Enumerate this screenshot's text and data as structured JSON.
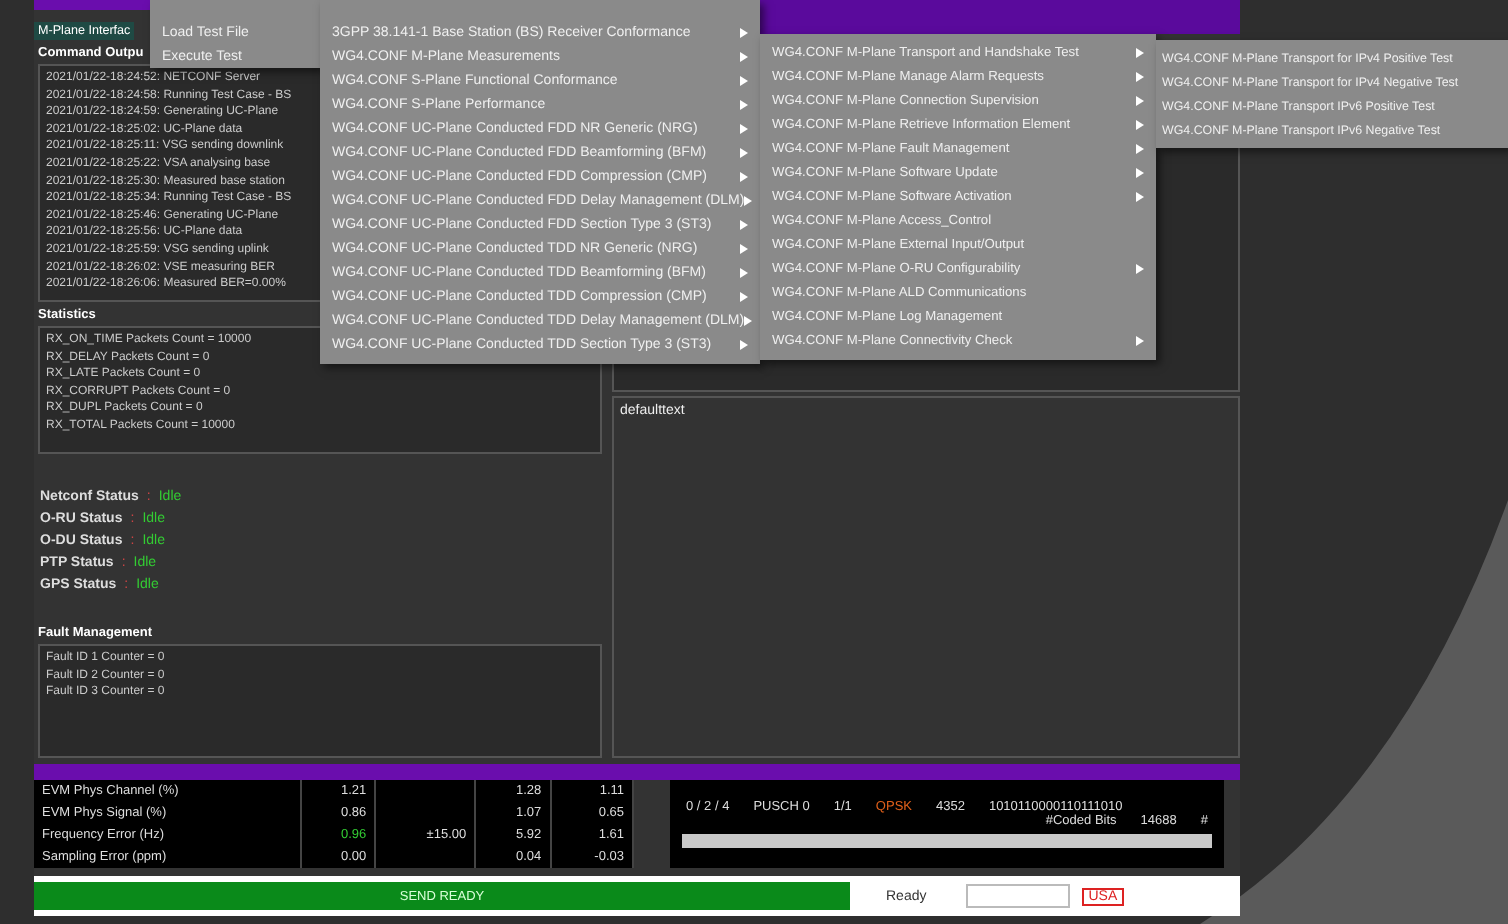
{
  "interface_tab": "M-Plane Interfac",
  "command_output": {
    "title": "Command Outpu",
    "lines": [
      "2021/01/22-18:24:52: NETCONF Server",
      "2021/01/22-18:24:58: Running Test Case - BS",
      "2021/01/22-18:24:59: Generating UC-Plane",
      "2021/01/22-18:25:02: UC-Plane data",
      "2021/01/22-18:25:11: VSG sending downlink",
      "2021/01/22-18:25:22: VSA analysing base",
      "2021/01/22-18:25:30: Measured base station",
      "2021/01/22-18:25:34: Running Test Case - BS",
      "2021/01/22-18:25:46: Generating UC-Plane",
      "2021/01/22-18:25:56: UC-Plane data",
      "2021/01/22-18:25:59: VSG sending uplink",
      "2021/01/22-18:26:02: VSE measuring BER",
      "2021/01/22-18:26:06: Measured BER=0.00%"
    ]
  },
  "statistics": {
    "title": "Statistics",
    "lines": [
      "RX_ON_TIME Packets Count = 10000",
      "RX_DELAY Packets Count = 0",
      "RX_LATE Packets Count = 0",
      "RX_CORRUPT Packets Count = 0",
      "RX_DUPL Packets Count = 0",
      "RX_TOTAL Packets Count = 10000"
    ]
  },
  "statuses": [
    {
      "label": "Netconf Status",
      "separator": ":",
      "value": "Idle"
    },
    {
      "label": "O-RU Status",
      "separator": ":",
      "value": "Idle"
    },
    {
      "label": "O-DU Status",
      "separator": ":",
      "value": "Idle"
    },
    {
      "label": "PTP Status",
      "separator": ":",
      "value": "Idle"
    },
    {
      "label": "GPS Status",
      "separator": ":",
      "value": "Idle"
    }
  ],
  "fault_management": {
    "title": "Fault Management",
    "lines": [
      "Fault ID 1 Counter = 0",
      "Fault ID 2 Counter = 0",
      "Fault ID 3 Counter = 0"
    ]
  },
  "default_text": "defaulttext",
  "menu": {
    "items": [
      "Load Test File",
      "Execute Test"
    ]
  },
  "submenu": [
    {
      "label": "3GPP 38.141-1 Base Station (BS) Receiver Conformance",
      "has_submenu": true
    },
    {
      "label": "WG4.CONF M-Plane Measurements",
      "has_submenu": true
    },
    {
      "label": "WG4.CONF S-Plane Functional Conformance",
      "has_submenu": true
    },
    {
      "label": "WG4.CONF S-Plane Performance",
      "has_submenu": true
    },
    {
      "label": "WG4.CONF UC-Plane Conducted FDD NR Generic (NRG)",
      "has_submenu": true
    },
    {
      "label": "WG4.CONF UC-Plane Conducted FDD Beamforming (BFM)",
      "has_submenu": true
    },
    {
      "label": "WG4.CONF UC-Plane Conducted FDD Compression (CMP)",
      "has_submenu": true
    },
    {
      "label": "WG4.CONF UC-Plane Conducted FDD Delay Management (DLM)",
      "has_submenu": true
    },
    {
      "label": "WG4.CONF UC-Plane Conducted FDD Section Type 3 (ST3)",
      "has_submenu": true
    },
    {
      "label": "WG4.CONF UC-Plane Conducted TDD NR Generic (NRG)",
      "has_submenu": true
    },
    {
      "label": "WG4.CONF UC-Plane Conducted TDD Beamforming (BFM)",
      "has_submenu": true
    },
    {
      "label": "WG4.CONF UC-Plane Conducted TDD Compression (CMP)",
      "has_submenu": true
    },
    {
      "label": "WG4.CONF UC-Plane Conducted TDD Delay Management (DLM)",
      "has_submenu": true
    },
    {
      "label": "WG4.CONF UC-Plane Conducted TDD Section Type 3 (ST3)",
      "has_submenu": true
    }
  ],
  "m_plane_menu": [
    {
      "label": "WG4.CONF M-Plane Transport and Handshake Test",
      "has_submenu": true
    },
    {
      "label": "WG4.CONF M-Plane Manage Alarm Requests",
      "has_submenu": true
    },
    {
      "label": "WG4.CONF M-Plane Connection Supervision",
      "has_submenu": true
    },
    {
      "label": "WG4.CONF M-Plane Retrieve Information Element",
      "has_submenu": true
    },
    {
      "label": "WG4.CONF M-Plane Fault Management",
      "has_submenu": true
    },
    {
      "label": "WG4.CONF M-Plane Software Update",
      "has_submenu": true
    },
    {
      "label": "WG4.CONF M-Plane Software Activation",
      "has_submenu": true
    },
    {
      "label": "WG4.CONF M-Plane Access_Control",
      "has_submenu": false
    },
    {
      "label": "WG4.CONF M-Plane External Input/Output",
      "has_submenu": false
    },
    {
      "label": "WG4.CONF M-Plane O-RU Configurability",
      "has_submenu": true
    },
    {
      "label": "WG4.CONF M-Plane ALD Communications",
      "has_submenu": false
    },
    {
      "label": "WG4.CONF M-Plane Log Management",
      "has_submenu": false
    },
    {
      "label": "WG4.CONF M-Plane Connectivity Check",
      "has_submenu": true
    }
  ],
  "transport_menu": [
    "WG4.CONF M-Plane Transport for IPv4 Positive Test",
    "WG4.CONF M-Plane Transport for IPv4 Negative Test",
    "WG4.CONF M-Plane Transport IPv6 Positive Test",
    "WG4.CONF M-Plane Transport IPv6 Negative Test"
  ],
  "measurements": [
    {
      "label": "EVM Phys Channel (%)",
      "value": "1.21",
      "pass": false,
      "column_4": "1.28",
      "column_5": "1.11"
    },
    {
      "label": "EVM Phys Signal (%)",
      "value": "0.86",
      "pass": false,
      "column_4": "1.07",
      "column_5": "0.65"
    },
    {
      "label": "Frequency Error (Hz)",
      "value": "0.96",
      "pass": true,
      "limit": "±15.00",
      "column_4": "5.92",
      "column_5": "1.61"
    },
    {
      "label": "Sampling Error (ppm)",
      "value": "0.00",
      "pass": false,
      "column_4": "0.04",
      "column_5": "-0.03"
    }
  ],
  "channel_rows": [
    {
      "cells": [
        {
          "text": "0 / 2 / 4",
          "alert": false
        },
        {
          "text": "PUSCH 0",
          "alert": false
        },
        {
          "text": "1/1",
          "alert": false
        },
        {
          "text": "QPSK",
          "alert": true
        },
        {
          "text": "4352",
          "alert": false
        },
        {
          "text": "1010110000110111010",
          "alert": false
        }
      ]
    },
    {
      "cells": [
        {
          "text": "#Coded Bits",
          "alert": false
        },
        {
          "text": "14688",
          "alert": false
        },
        {
          "text": "#",
          "alert": false
        }
      ]
    }
  ],
  "status_bar": {
    "message": "SEND READY",
    "state": "Ready",
    "code": "USA"
  }
}
